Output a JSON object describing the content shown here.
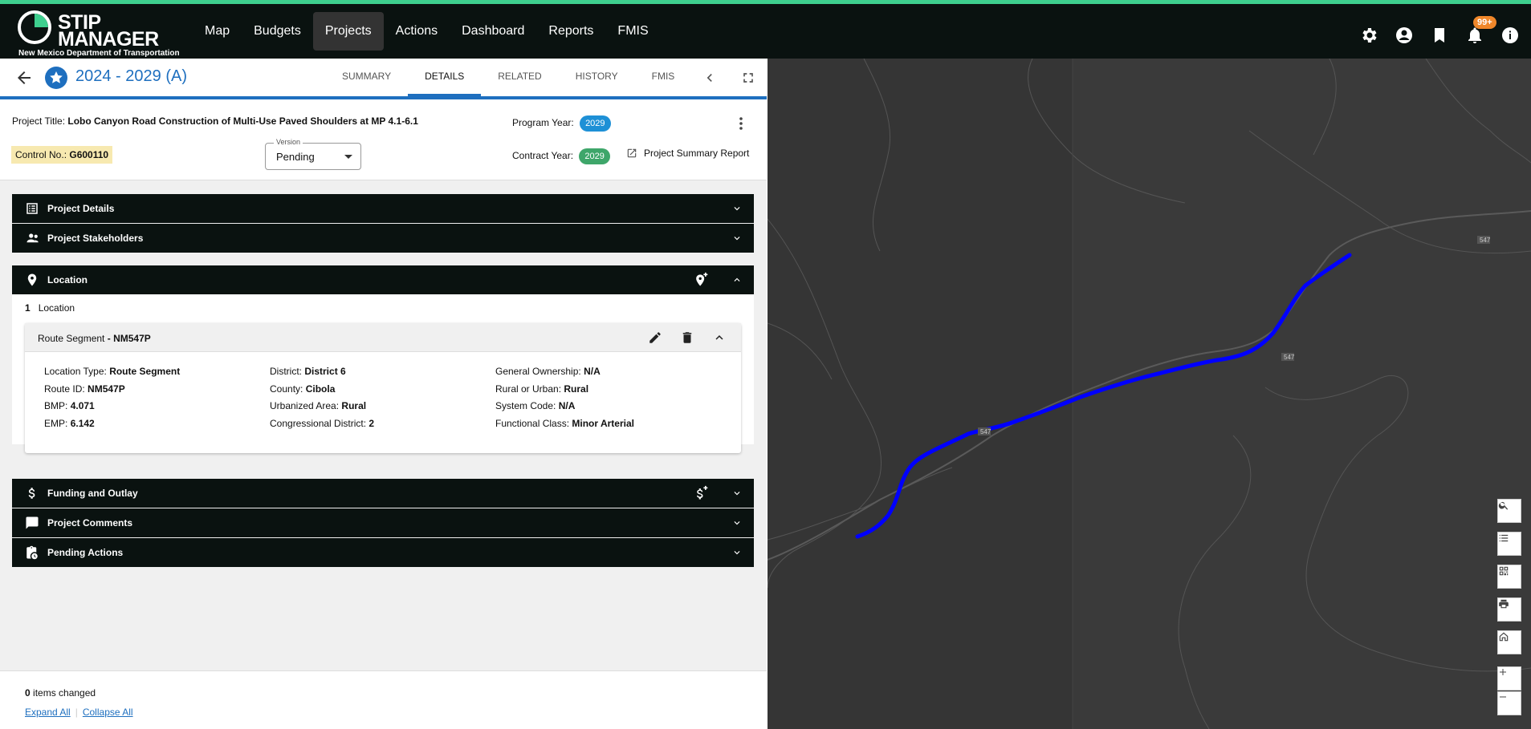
{
  "app": {
    "logo_line1": "STIP",
    "logo_line2": "MANAGER",
    "logo_sub": "New Mexico Department of Transportation",
    "nav": [
      "Map",
      "Budgets",
      "Projects",
      "Actions",
      "Dashboard",
      "Reports",
      "FMIS"
    ],
    "active_nav": "Projects",
    "notification_badge": "99+"
  },
  "header": {
    "title": "2024 - 2029 (A)",
    "tabs": [
      "SUMMARY",
      "DETAILS",
      "RELATED",
      "HISTORY",
      "FMIS"
    ],
    "active_tab": "DETAILS"
  },
  "project": {
    "title_label": "Project Title:",
    "title_value": "Lobo Canyon Road Construction of Multi-Use Paved Shoulders at MP 4.1-6.1",
    "control_label": "Control No.:",
    "control_value": "G600110",
    "version_label": "Version",
    "version_value": "Pending",
    "program_year_label": "Program Year:",
    "program_year": "2029",
    "contract_year_label": "Contract Year:",
    "contract_year": "2029",
    "summary_report": "Project Summary Report"
  },
  "sections": {
    "project_details": "Project Details",
    "stakeholders": "Project Stakeholders",
    "location": "Location",
    "funding": "Funding and Outlay",
    "comments": "Project Comments",
    "pending": "Pending Actions"
  },
  "location": {
    "count": "1",
    "count_label": "Location",
    "segment_title": "Route Segment",
    "segment_id": "NM547P",
    "fields_col1": [
      {
        "label": "Location Type:",
        "value": "Route Segment"
      },
      {
        "label": "Route ID:",
        "value": "NM547P"
      },
      {
        "label": "BMP:",
        "value": "4.071"
      },
      {
        "label": "EMP:",
        "value": "6.142"
      }
    ],
    "fields_col2": [
      {
        "label": "District:",
        "value": "District 6"
      },
      {
        "label": "County:",
        "value": "Cibola"
      },
      {
        "label": "Urbanized Area:",
        "value": "Rural"
      },
      {
        "label": "Congressional District:",
        "value": "2"
      }
    ],
    "fields_col3": [
      {
        "label": "General Ownership:",
        "value": "N/A"
      },
      {
        "label": "Rural or Urban:",
        "value": "Rural"
      },
      {
        "label": "System Code:",
        "value": "N/A"
      },
      {
        "label": "Functional Class:",
        "value": "Minor Arterial"
      }
    ]
  },
  "footer": {
    "changed_count": "0",
    "changed_label": "items changed",
    "expand_all": "Expand All",
    "collapse_all": "Collapse All"
  },
  "map": {
    "route_label": "547",
    "route_color": "#0000ff",
    "background": "#3a3a3a"
  }
}
